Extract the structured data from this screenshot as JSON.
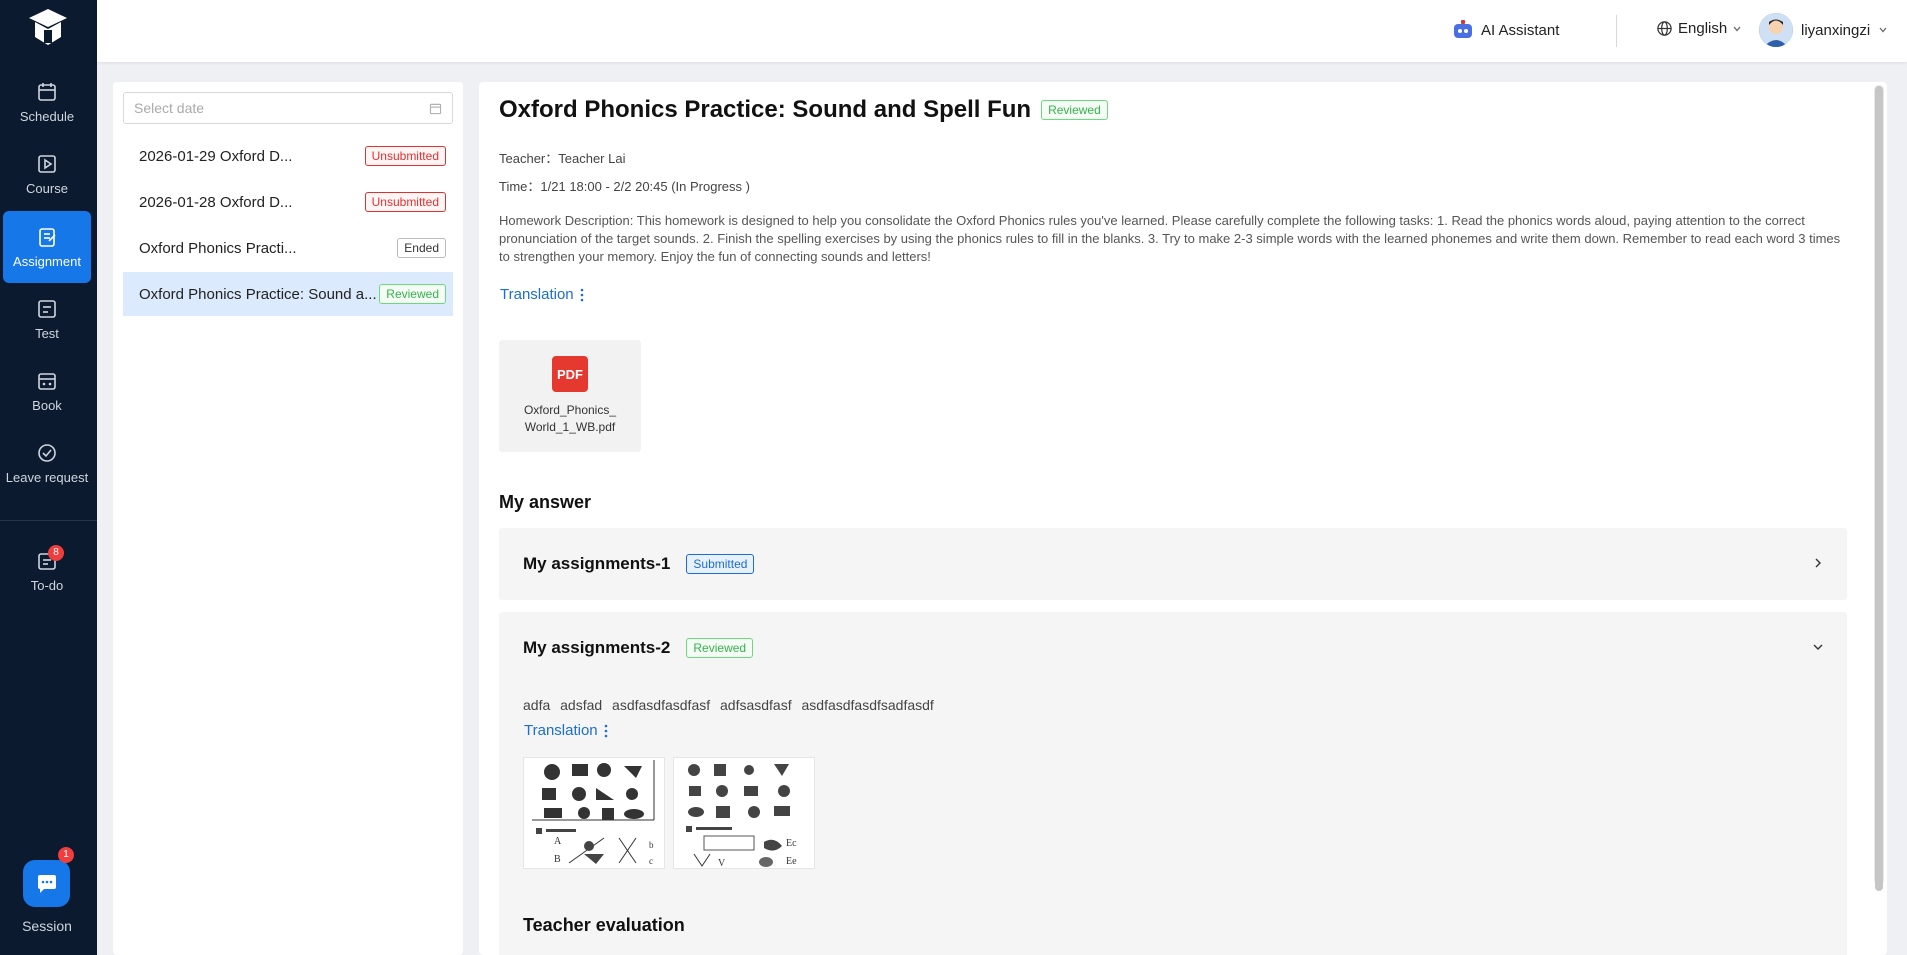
{
  "sidebar": {
    "items": [
      {
        "label": "Schedule",
        "icon": "calendar-icon"
      },
      {
        "label": "Course",
        "icon": "video-icon"
      },
      {
        "label": "Assignment",
        "icon": "assignment-icon",
        "active": true
      },
      {
        "label": "Test",
        "icon": "test-icon"
      },
      {
        "label": "Book",
        "icon": "book-icon"
      },
      {
        "label": "Leave request",
        "icon": "leave-icon"
      }
    ],
    "todo": {
      "label": "To-do",
      "badge": "8"
    },
    "session": {
      "label": "Session",
      "badge": "1"
    }
  },
  "header": {
    "ai_assistant": "AI Assistant",
    "language": "English",
    "username": "liyanxingzi"
  },
  "list": {
    "date_placeholder": "Select date",
    "items": [
      {
        "title": "2026-01-29 Oxford D...",
        "status": "Unsubmitted"
      },
      {
        "title": "2026-01-28 Oxford D...",
        "status": "Unsubmitted"
      },
      {
        "title": "Oxford Phonics Practi...",
        "status": "Ended"
      },
      {
        "title": "Oxford Phonics Practice: Sound a...",
        "status": "Reviewed"
      }
    ]
  },
  "detail": {
    "title": "Oxford Phonics Practice: Sound and Spell Fun",
    "status": "Reviewed",
    "teacher_label": "Teacher：",
    "teacher": "Teacher Lai",
    "time_label": "Time：",
    "time": "1/21 18:00 - 2/2 20:45 (In Progress )",
    "description": "Homework Description: This homework is designed to help you consolidate the Oxford Phonics rules you've learned. Please carefully complete the following tasks: 1. Read the phonics words aloud, paying attention to the correct pronunciation of the target sounds. 2. Finish the spelling exercises by using the phonics rules to fill in the blanks. 3. Try to make 2-3 simple words with the learned phonemes and write them down. Remember to read each word 3 times to strengthen your memory. Enjoy the fun of connecting sounds and letters!",
    "translation": "Translation",
    "attachment": {
      "type": "PDF",
      "name_line1": "Oxford_Phonics_",
      "name_line2": "World_1_WB.pdf"
    },
    "my_answer": "My answer",
    "assignments": [
      {
        "title": "My assignments-1",
        "status": "Submitted"
      },
      {
        "title": "My assignments-2",
        "status": "Reviewed",
        "text": "adfa  adsfad  asdfasdfasdfasf   adfsasdfasf  asdfasdfasdfsadfasdf",
        "translation": "Translation"
      }
    ],
    "teacher_evaluation": "Teacher evaluation"
  },
  "colors": {
    "sidebar_bg": "#0b1a2e",
    "accent": "#1677e8",
    "danger": "#e03131",
    "success": "#37b24d"
  }
}
